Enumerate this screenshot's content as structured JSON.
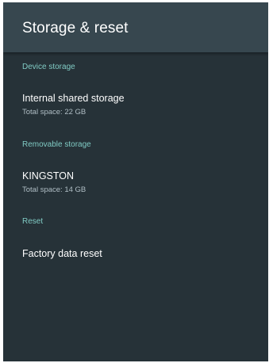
{
  "app_bar": {
    "title": "Storage & reset"
  },
  "sections": {
    "device_storage": {
      "header": "Device storage",
      "item": {
        "title": "Internal shared storage",
        "summary": "Total space: 22 GB"
      }
    },
    "removable_storage": {
      "header": "Removable storage",
      "item": {
        "title": "KINGSTON",
        "summary": "Total space: 14 GB"
      }
    },
    "reset": {
      "header": "Reset",
      "item": {
        "title": "Factory data reset"
      }
    }
  },
  "colors": {
    "app_bar": "#37474f",
    "background": "#263238",
    "section_header": "#80cbc4",
    "title_text": "#ffffff",
    "summary_text": "#b0bec5"
  }
}
